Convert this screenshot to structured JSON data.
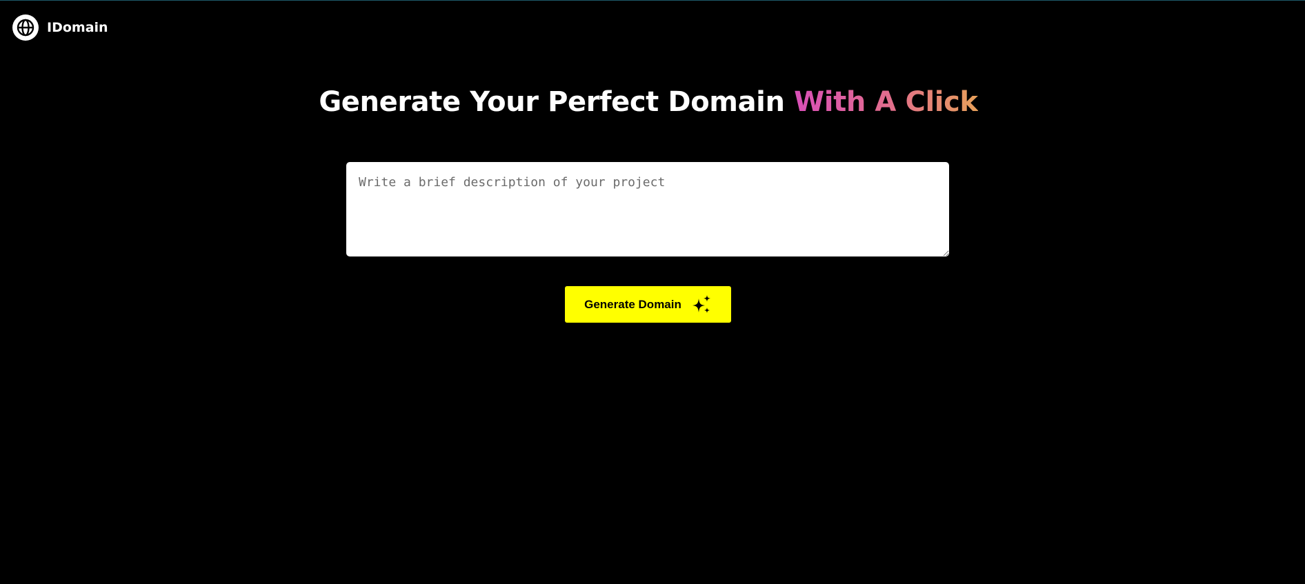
{
  "colors": {
    "background": "#000000",
    "button_background": "#ffff00",
    "accent_gradient_start": "#d94fb8",
    "accent_gradient_end": "#e7a05a"
  },
  "header": {
    "logo_icon": "globe-icon",
    "brand_name": "IDomain"
  },
  "hero": {
    "title_plain": "Generate Your Perfect Domain ",
    "title_accent": "With A Click"
  },
  "form": {
    "description_placeholder": "Write a brief description of your project",
    "description_value": "",
    "generate_label": "Generate Domain",
    "generate_icon": "sparkles-icon"
  }
}
